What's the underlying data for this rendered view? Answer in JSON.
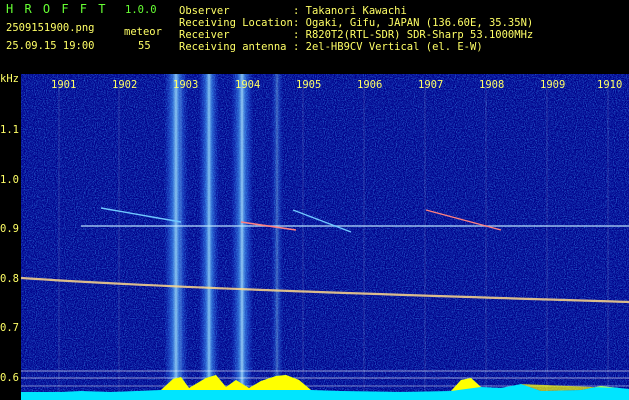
{
  "app": {
    "name": "H R O F F T",
    "version": "1.0.0"
  },
  "file": {
    "name": "2509151900.png",
    "datetime": "25.09.15 19:00"
  },
  "counter": {
    "label": "meteor",
    "value": "55"
  },
  "station": [
    {
      "key": "Observer",
      "value": ": Takanori Kawachi"
    },
    {
      "key": "Receiving Location",
      "value": ": Ogaki, Gifu, JAPAN (136.60E, 35.35N)"
    },
    {
      "key": "Receiver",
      "value": ": R820T2(RTL-SDR) SDR-Sharp 53.1000MHz"
    },
    {
      "key": "Receiving antenna",
      "value": ": 2el-HB9CV Vertical (el. E-W)"
    }
  ],
  "yaxis": {
    "unit": "kHz",
    "ticks": [
      "1.1",
      "1.0",
      "0.9",
      "0.8",
      "0.7",
      "0.6"
    ]
  },
  "xaxis": {
    "ticks": [
      "1901",
      "1902",
      "1903",
      "1904",
      "1905",
      "1906",
      "1907",
      "1908",
      "1909",
      "1910"
    ]
  },
  "colors": {
    "bg": "#00008a",
    "label": "#ffff66",
    "trace": "#ffffff",
    "signal": "#ffd700",
    "meteor_echo": "#70c8ff"
  }
}
